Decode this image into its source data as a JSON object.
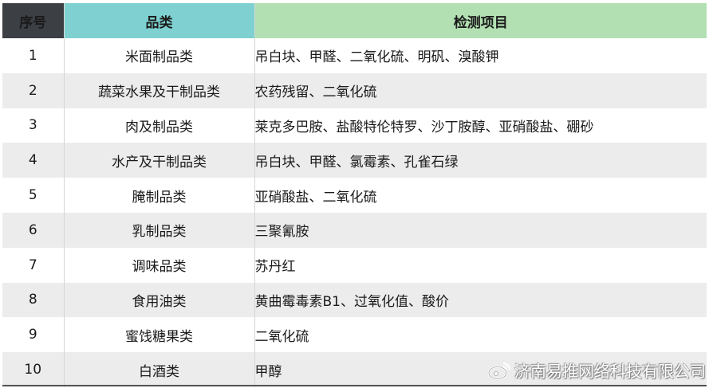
{
  "headers": {
    "no": "序号",
    "category": "品类",
    "items": "检测项目"
  },
  "rows": [
    {
      "no": "1",
      "category": "米面制品类",
      "items": "吊白块、甲醛、二氧化硫、明矾、溴酸钾"
    },
    {
      "no": "2",
      "category": "蔬菜水果及干制品类",
      "items": "农药残留、二氧化硫"
    },
    {
      "no": "3",
      "category": "肉及制品类",
      "items": "莱克多巴胺、盐酸特伦特罗、沙丁胺醇、亚硝酸盐、硼砂"
    },
    {
      "no": "4",
      "category": "水产及干制品类",
      "items": "吊白块、甲醛、氯霉素、孔雀石绿"
    },
    {
      "no": "5",
      "category": "腌制品类",
      "items": "亚硝酸盐、二氧化硫"
    },
    {
      "no": "6",
      "category": "乳制品类",
      "items": "三聚氰胺"
    },
    {
      "no": "7",
      "category": "调味品类",
      "items": "苏丹红"
    },
    {
      "no": "8",
      "category": "食用油类",
      "items": "黄曲霉毒素B1、过氧化值、酸价"
    },
    {
      "no": "9",
      "category": "蜜饯糖果类",
      "items": "二氧化硫"
    },
    {
      "no": "10",
      "category": "白酒类",
      "items": "甲醇"
    }
  ],
  "watermark": {
    "text": "济南易推网络科技有限公司",
    "icon": "weibo-logo-icon"
  },
  "colors": {
    "header_no": "#3c3f44",
    "header_category": "#7fd0d0",
    "header_items": "#b2e0b2",
    "row_alt": "#ececec"
  }
}
